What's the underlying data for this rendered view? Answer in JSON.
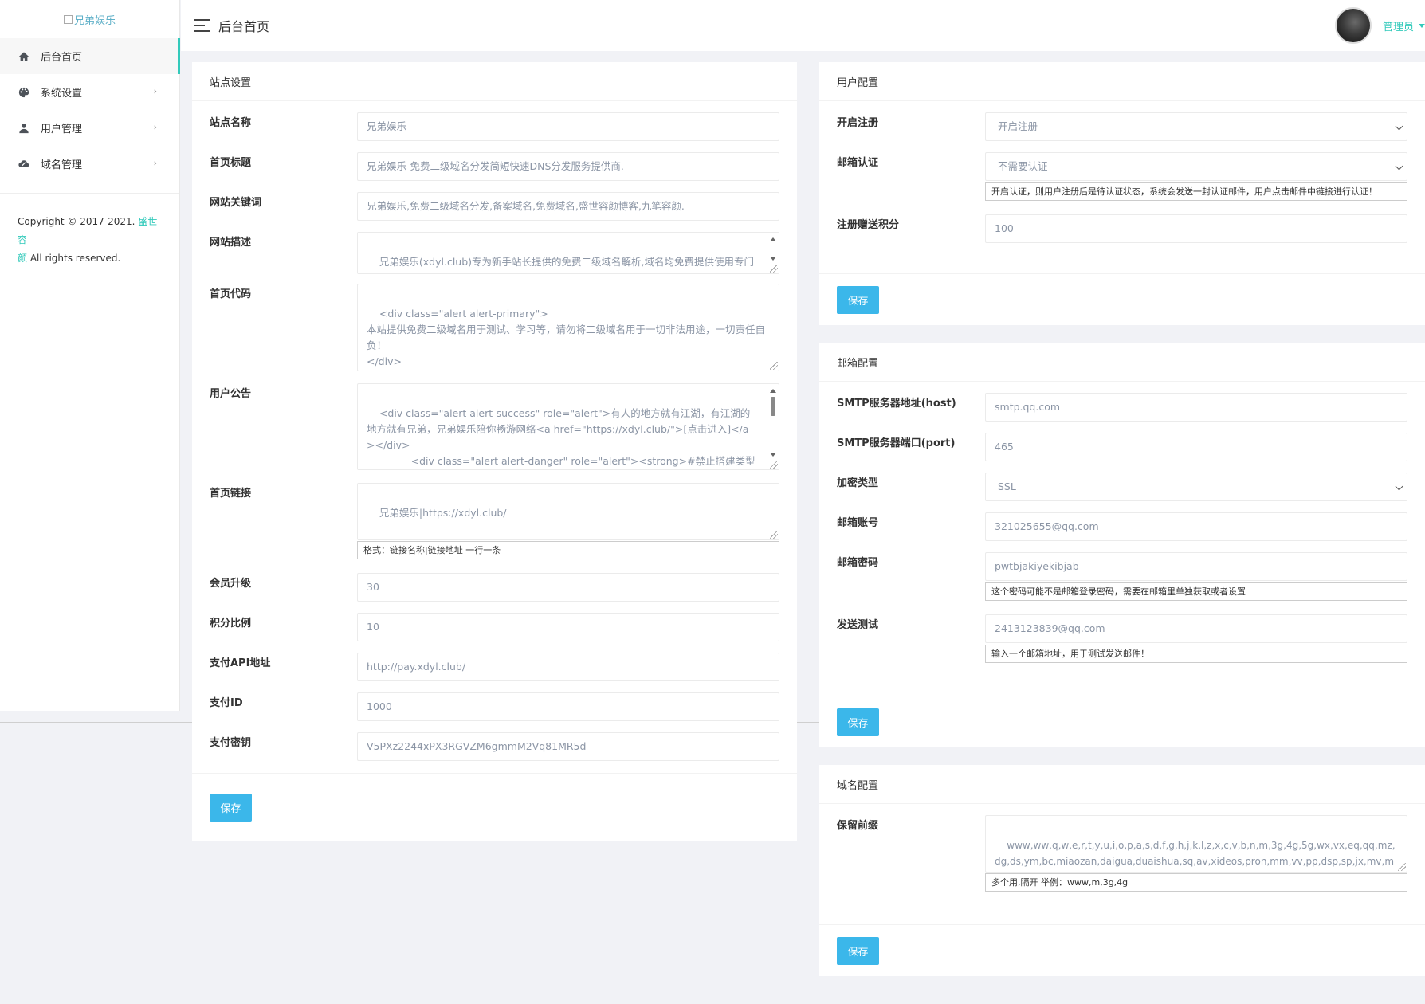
{
  "brand": {
    "logo_alt": "兄弟娱乐"
  },
  "sidebar": {
    "items": [
      {
        "label": "后台首页",
        "icon": "home-icon"
      },
      {
        "label": "系统设置",
        "icon": "palette-icon"
      },
      {
        "label": "用户管理",
        "icon": "user-icon"
      },
      {
        "label": "域名管理",
        "icon": "cloud-icon"
      }
    ],
    "copyright_line1": "Copyright © 2017-2021. ",
    "copyright_link_a": "盛世容",
    "copyright_link_b": "颜",
    "copyright_line2": " All rights reserved."
  },
  "header": {
    "title": "后台首页",
    "user_name": "管理员"
  },
  "site_settings": {
    "title": "站点设置",
    "fields": {
      "site_name": {
        "label": "站点名称",
        "value": "兄弟娱乐"
      },
      "home_title": {
        "label": "首页标题",
        "value": "兄弟娱乐-免费二级域名分发简短快速DNS分发服务提供商."
      },
      "keywords": {
        "label": "网站关键词",
        "value": "兄弟娱乐,免费二级域名分发,备案域名,免费域名,盛世容颜博客,九笔容颜."
      },
      "description": {
        "label": "网站描述",
        "value": "兄弟娱乐(xdyl.club)专为新手站长提供的免费二级域名解析,域名均免费提供使用专门提供二级域名解析的平台,域名均免费提供使用,不收取任何费用,提供的域名当中有已"
      },
      "home_code": {
        "label": "首页代码",
        "value": "<div class=\"alert alert-primary\">\n本站提供免费二级域名用于测试、学习等，请勿将二级域名用于一切非法用途，一切责任自负！\n</div>"
      },
      "notice": {
        "label": "用户公告",
        "value": "<div class=\"alert alert-success\" role=\"alert\">有人的地方就有江湖，有江湖的地方就有兄弟，兄弟娱乐陪你畅游网络<a href=\"https://xdyl.club/\">[点击进入]</a></div>\n              <div class=\"alert alert-danger\" role=\"alert\"><strong>#禁止搭建类型#</strong> 伪造、钓鱼、诈骗、外挂、VPN、毒品、赌博、博彩、棋牌、彩票、虚假打赏、黄色、贷款、色情交友、盗版影视、不正常言论、不合法的信息收集、圈币等"
      },
      "home_links": {
        "label": "首页链接",
        "value": "兄弟娱乐|https://xdyl.club/",
        "help": "格式：链接名称|链接地址 一行一条"
      },
      "member_upgrade": {
        "label": "会员升级",
        "value": "30"
      },
      "points_ratio": {
        "label": "积分比例",
        "value": "10"
      },
      "pay_api": {
        "label": "支付API地址",
        "value": "http://pay.xdyl.club/"
      },
      "pay_id": {
        "label": "支付ID",
        "value": "1000"
      },
      "pay_key": {
        "label": "支付密钥",
        "value": "V5PXz2244xPX3RGVZM6gmmM2Vq81MR5d"
      }
    },
    "save_label": "保存"
  },
  "user_config": {
    "title": "用户配置",
    "fields": {
      "register": {
        "label": "开启注册",
        "value": "开启注册"
      },
      "email_verify": {
        "label": "邮箱认证",
        "value": "不需要认证",
        "help": "开启认证，则用户注册后是待认证状态，系统会发送一封认证邮件，用户点击邮件中链接进行认证！"
      },
      "register_points": {
        "label": "注册赠送积分",
        "value": "100"
      }
    },
    "save_label": "保存"
  },
  "mail_config": {
    "title": "邮箱配置",
    "fields": {
      "smtp_host": {
        "label": "SMTP服务器地址(host)",
        "value": "smtp.qq.com"
      },
      "smtp_port": {
        "label": "SMTP服务器端口(port)",
        "value": "465"
      },
      "encryption": {
        "label": "加密类型",
        "value": "SSL"
      },
      "account": {
        "label": "邮箱账号",
        "value": "321025655@qq.com"
      },
      "password": {
        "label": "邮箱密码",
        "value": "pwtbjakiyekibjab",
        "help": "这个密码可能不是邮箱登录密码，需要在邮箱里单独获取或者设置"
      },
      "send_test": {
        "label": "发送测试",
        "value": "2413123839@qq.com",
        "help": "输入一个邮箱地址，用于测试发送邮件！"
      }
    },
    "save_label": "保存"
  },
  "domain_config": {
    "title": "域名配置",
    "fields": {
      "reserved_prefix": {
        "label": "保留前缀",
        "value": "www,ww,q,w,e,r,t,y,u,i,o,p,a,s,d,f,g,h,j,k,l,z,x,c,v,b,n,m,3g,4g,5g,wx,vx,eq,qq,mz,dg,ds,ym,bc,miaozan,daigua,duaishua,sq,av,xideos,pron,mm,vv,pp,dsp,sp,jx,mv,music,video,superry,jbry,vvv,hs,idc,cloud,vpn,fq,fh,url,dwz",
        "help": "多个用,隔开 举例：www,m,3g,4g"
      }
    },
    "save_label": "保存"
  }
}
